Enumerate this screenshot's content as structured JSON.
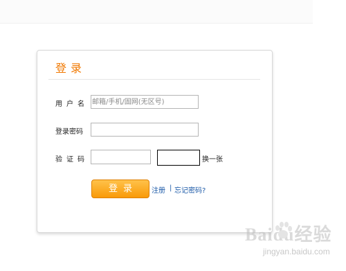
{
  "form": {
    "title": "登录",
    "username_label": "用户名",
    "username_placeholder": "邮箱/手机/固网(无区号)",
    "password_label": "登录密码",
    "captcha_label": "验证码",
    "refresh_captcha": "换一张",
    "submit_label": "登录"
  },
  "links": {
    "register": "注册",
    "separator": "|",
    "forgot_password": "忘记密码?"
  },
  "watermark": {
    "brand": "Baidu经验",
    "url": "jingyan.baidu.com"
  },
  "colors": {
    "accent": "#f07800",
    "button": "#f99a08",
    "link": "#1c5aa8"
  }
}
